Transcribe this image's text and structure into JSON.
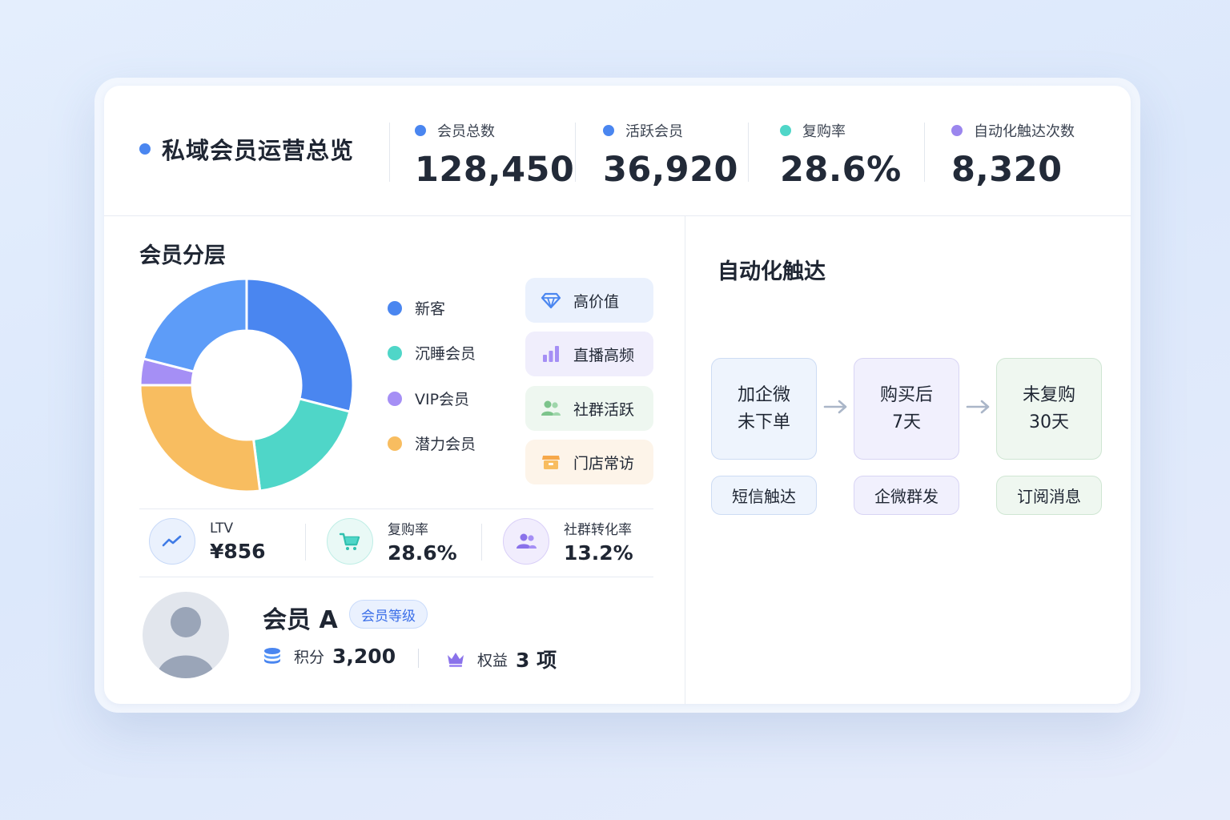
{
  "header": {
    "title": "私域会员运营总览",
    "kpis": [
      {
        "label": "会员总数",
        "value": "128,450",
        "color": "#4a86f0"
      },
      {
        "label": "活跃会员",
        "value": "36,920",
        "color": "#4a86f0"
      },
      {
        "label": "复购率",
        "value": "28.6%",
        "color": "#4fd6c8"
      },
      {
        "label": "自动化触达次数",
        "value": "8,320",
        "color": "#9b86ee"
      }
    ]
  },
  "segments": {
    "title": "会员分层",
    "legend": [
      {
        "label": "新客",
        "color": "#4a86f0"
      },
      {
        "label": "沉睡会员",
        "color": "#4fd6c8"
      },
      {
        "label": "VIP会员",
        "color": "#a58ff5"
      },
      {
        "label": "潜力会员",
        "color": "#f8bd60"
      }
    ],
    "tags": [
      {
        "label": "高价值",
        "icon": "diamond-icon"
      },
      {
        "label": "直播高频",
        "icon": "bar-chart-icon"
      },
      {
        "label": "社群活跃",
        "icon": "users-icon"
      },
      {
        "label": "门店常访",
        "icon": "store-icon"
      }
    ]
  },
  "chart_data": {
    "type": "pie",
    "categories": [
      "新客",
      "沉睡会员",
      "VIP会员",
      "潜力会员"
    ],
    "values": [
      29,
      19,
      27,
      4,
      21
    ],
    "slice_labels": [
      "新客",
      "沉睡会员",
      "潜力会员",
      "VIP会员",
      ""
    ],
    "colors": [
      "#4a86f0",
      "#4fd6c8",
      "#f8bd60",
      "#a58ff5",
      "#5d9cf8"
    ],
    "order": [
      "新客",
      "沉睡会员",
      "潜力会员",
      "VIP会员",
      "(浅蓝)"
    ]
  },
  "metrics": [
    {
      "label": "LTV",
      "value": "¥856",
      "icon": "trend-up-icon"
    },
    {
      "label": "复购率",
      "value": "28.6%",
      "icon": "cart-icon"
    },
    {
      "label": "社群转化率",
      "value": "13.2%",
      "icon": "group-icon"
    }
  ],
  "member": {
    "name": "会员 A",
    "badge": "会员等级",
    "points_label": "积分",
    "points_value": "3,200",
    "benefits_label": "权益",
    "benefits_value": "3 项"
  },
  "automation": {
    "title": "自动化触达",
    "steps": [
      {
        "line1": "加企微",
        "line2": "未下单"
      },
      {
        "line1": "购买后",
        "line2": "7天"
      },
      {
        "line1": "未复购",
        "line2": "30天"
      }
    ],
    "channels": [
      "短信触达",
      "企微群发",
      "订阅消息"
    ]
  }
}
